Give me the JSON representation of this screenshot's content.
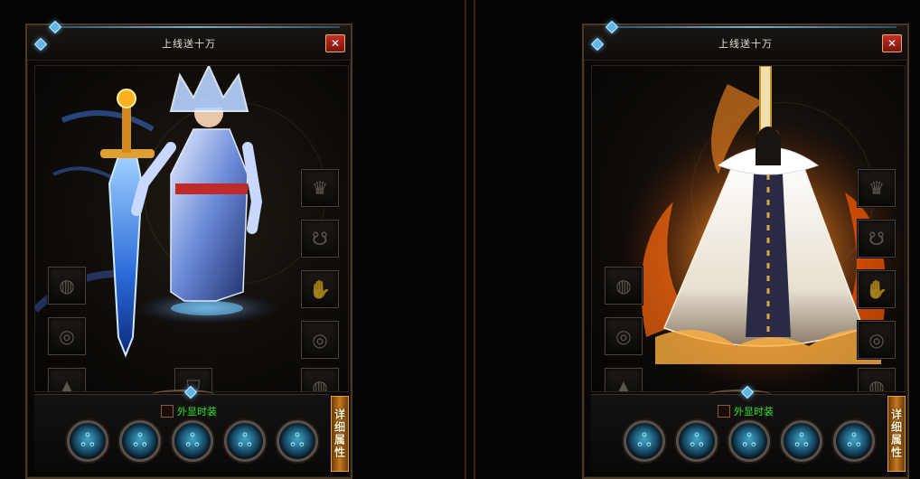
{
  "panels": [
    {
      "title": "上线送十万",
      "close_label": "✕",
      "fashion_label": "外显时装",
      "detail_tab_label": "详细属性",
      "character_theme": "ice-blue-warrior",
      "accent_color": "#4aa8f0"
    },
    {
      "title": "上线送十万",
      "close_label": "✕",
      "fashion_label": "外显时装",
      "detail_tab_label": "详细属性",
      "character_theme": "flame-mage",
      "accent_color": "#ff7a1a"
    }
  ],
  "slot_icons": {
    "left": [
      "bracelet-icon",
      "ring-icon",
      "boots-icon"
    ],
    "right": [
      "helmet-icon",
      "necklace-icon",
      "gloves-icon",
      "ring-icon",
      "bracelet-icon"
    ],
    "bottom": "boots-icon"
  },
  "orb_count": 5,
  "colors": {
    "frame": "#4a3a24",
    "fashion_text": "#2ee62e",
    "close_button": "#c43025",
    "side_tab": "#c87a20"
  }
}
